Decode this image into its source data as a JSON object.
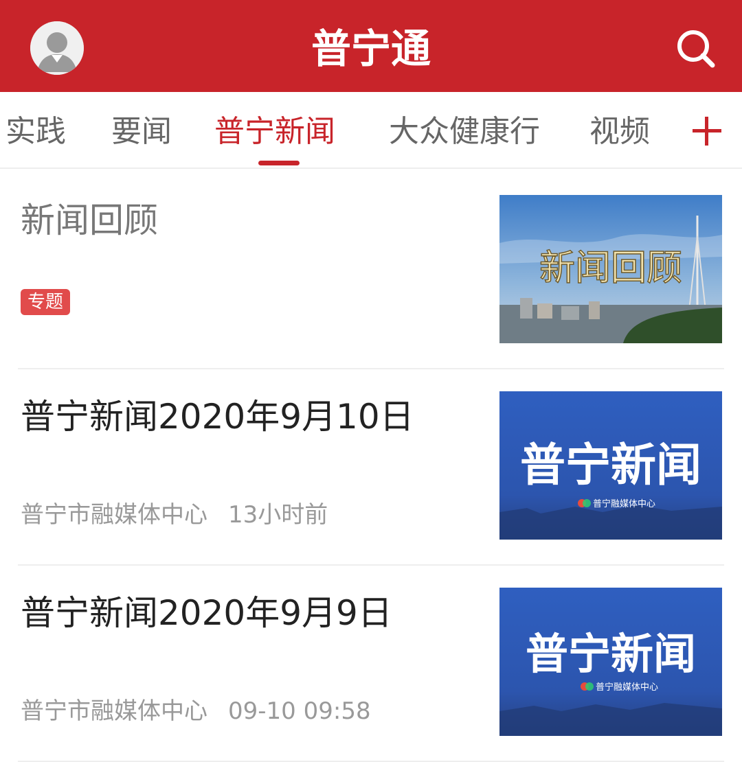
{
  "header": {
    "title": "普宁通",
    "avatar_icon": "user-avatar-icon",
    "search_icon": "search-icon",
    "color": "#c8242a"
  },
  "tabs": {
    "items": [
      {
        "label": "实践",
        "active": false
      },
      {
        "label": "要闻",
        "active": false
      },
      {
        "label": "普宁新闻",
        "active": true
      },
      {
        "label": "大众健康行",
        "active": false
      },
      {
        "label": "视频",
        "active": false
      }
    ],
    "add_icon": "plus-icon"
  },
  "news": [
    {
      "title": "新闻回顾",
      "badge": "专题",
      "thumb_text": "新闻回顾"
    },
    {
      "title": "普宁新闻2020年9月10日",
      "source": "普宁市融媒体中心",
      "time": "13小时前",
      "thumb_text": "普宁新闻",
      "thumb_sub": "普宁融媒体中心"
    },
    {
      "title": "普宁新闻2020年9月9日",
      "source": "普宁市融媒体中心",
      "time": "09-10 09:58",
      "thumb_text": "普宁新闻",
      "thumb_sub": "普宁融媒体中心"
    }
  ]
}
